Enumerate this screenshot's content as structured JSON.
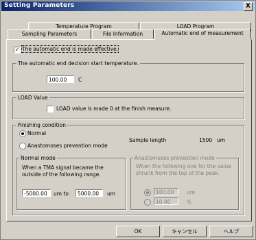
{
  "window": {
    "title": "Setting Parameters",
    "close_symbol": "X"
  },
  "tabs": [
    {
      "label": "Temperature Program"
    },
    {
      "label": "LOAD Program"
    },
    {
      "label": "Sampling Parameters"
    },
    {
      "label": "File Information"
    },
    {
      "label": "Automatic end of measurement",
      "active": true
    }
  ],
  "auto_end": {
    "effective_label": "The automatic end is made effective.",
    "effective_checked": true,
    "check_mark": "✓"
  },
  "start_temp": {
    "group_title": "The automatic end decision start temperature.",
    "value": "100.00",
    "unit": "C"
  },
  "load_value": {
    "group_title": "LOAD Value",
    "checkbox_label": "LOAD value is made 0 at the finish measure.",
    "checked": false
  },
  "finishing": {
    "group_title": "Finishing condition",
    "option_normal": "Normal",
    "option_anastomoses": "Anastomoses prevention mode",
    "selected": "normal",
    "sample_length_label": "Sample length",
    "sample_length_value": "1500",
    "sample_length_unit": "um"
  },
  "normal_mode": {
    "group_title": "Normal mode",
    "description": "When a TMA signal became the outside of the following range.",
    "min_value": "-5000.00",
    "to_label": "um to",
    "max_value": "5000.00",
    "max_unit": "um"
  },
  "anastomoses_mode": {
    "group_title": "Anastomoses prevention mode",
    "description": "When the following one for the value shrunk from the top of the peak.",
    "value_um": "100.00",
    "unit_um": "um",
    "value_pct": "10.00",
    "unit_pct": "%"
  },
  "buttons": {
    "ok": "OK",
    "cancel": "キャンセル",
    "help": "ヘルプ"
  }
}
